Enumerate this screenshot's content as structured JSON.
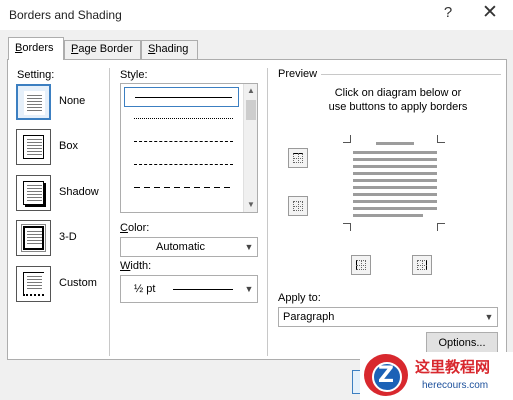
{
  "window": {
    "title": "Borders and Shading",
    "help_glyph": "?",
    "close_glyph": "✕"
  },
  "tabs": [
    {
      "label": "Borders",
      "mnemonic": "B",
      "rest": "orders",
      "active": true
    },
    {
      "label": "Page Border",
      "mnemonic": "P",
      "rest": "age Border",
      "active": false
    },
    {
      "label": "Shading",
      "mnemonic": "S",
      "rest": "hading",
      "active": false
    }
  ],
  "setting": {
    "label": "Setting:",
    "options": [
      {
        "label": "None",
        "selected": true,
        "icon": "setting-none-icon"
      },
      {
        "label": "Box",
        "selected": false,
        "icon": "setting-box-icon"
      },
      {
        "label": "Shadow",
        "selected": false,
        "icon": "setting-shadow-icon"
      },
      {
        "label": "3-D",
        "selected": false,
        "icon": "setting-3d-icon"
      },
      {
        "label": "Custom",
        "selected": false,
        "icon": "setting-custom-icon"
      }
    ]
  },
  "style": {
    "label": "Style:",
    "items": [
      "solid",
      "dotted",
      "small-dash",
      "dash",
      "long-dash"
    ],
    "selected_index": 0
  },
  "color": {
    "label": "Color:",
    "value": "Automatic"
  },
  "width": {
    "label": "Width:",
    "value": "½ pt"
  },
  "preview": {
    "label": "Preview",
    "hint_line1": "Click on diagram below or",
    "hint_line2": "use buttons to apply borders"
  },
  "apply_to": {
    "label": "Apply to:",
    "value": "Paragraph"
  },
  "options_button": "Options...",
  "watermark": {
    "title": "这里教程网",
    "url": "herecours.com",
    "logo_letter": "Z"
  },
  "colors": {
    "accent": "#3c7fc1",
    "panel": "#ffffff",
    "dialog": "#f0f0f0",
    "border": "#adadad",
    "watermark_red": "#d8282e",
    "watermark_blue": "#1b61b6"
  }
}
